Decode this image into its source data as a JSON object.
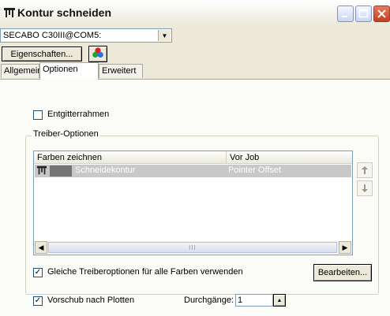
{
  "window": {
    "title": "Kontur schneiden"
  },
  "device": {
    "selected": "SECABO C30III@COM5:"
  },
  "buttons": {
    "properties": "Eigenschaften...",
    "edit": "Bearbeiten..."
  },
  "tabs": [
    {
      "label": "Allgemein",
      "active": false
    },
    {
      "label": "Optionen",
      "active": true
    },
    {
      "label": "Erweitert",
      "active": false
    }
  ],
  "options": {
    "weed_frame": {
      "label": "Entgitterrahmen",
      "checked": false
    },
    "driver_group_label": "Treiber-Optionen",
    "same_options": {
      "label": "Gleiche Treiberoptionen für alle Farben verwenden",
      "checked": true
    },
    "feed_after": {
      "label": "Vorschub nach Plotten",
      "checked": true
    },
    "passes": {
      "label": "Durchgänge:",
      "value": "1"
    }
  },
  "color_table": {
    "columns": [
      "Farben zeichnen",
      "Vor Job"
    ],
    "rows": [
      {
        "name": "Schneidekontur",
        "pre_job": "Pointer Offset",
        "swatch_color": "#747474"
      }
    ]
  },
  "scrollbar": {
    "thumb_grip": "III"
  }
}
